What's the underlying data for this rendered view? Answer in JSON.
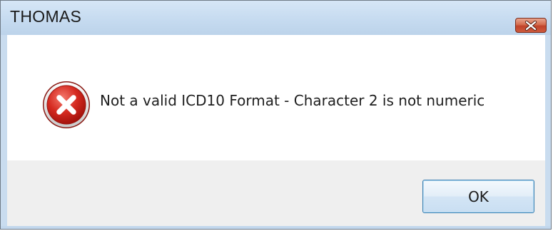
{
  "window": {
    "title": "THOMAS",
    "close_icon": "close-x-icon"
  },
  "dialog": {
    "icon": "error-icon",
    "message": "Not a valid ICD10 Format - Character 2 is not numeric",
    "ok_label": "OK"
  },
  "colors": {
    "titlebar": "#c6dbf0",
    "close_button": "#c7492f",
    "error_icon": "#d0271f",
    "button_border": "#3c7fb1",
    "footer": "#efefef"
  }
}
